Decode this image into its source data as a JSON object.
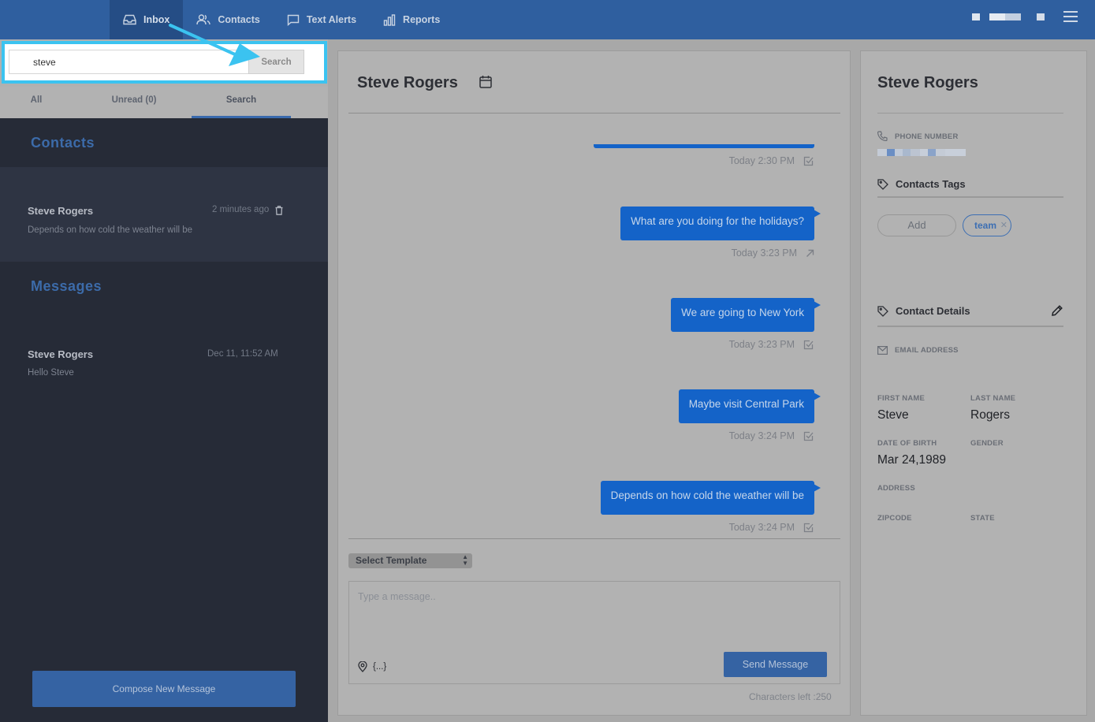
{
  "nav": {
    "items": [
      {
        "label": "Inbox",
        "icon": "inbox-icon",
        "active": true
      },
      {
        "label": "Contacts",
        "icon": "contacts-icon",
        "active": false
      },
      {
        "label": "Text Alerts",
        "icon": "chat-bubble-icon",
        "active": false
      },
      {
        "label": "Reports",
        "icon": "bar-chart-icon",
        "active": false
      }
    ],
    "menu_icon": "hamburger-icon"
  },
  "search": {
    "value": "steve",
    "button_label": "Search"
  },
  "tabs": [
    {
      "label": "All",
      "active": false
    },
    {
      "label": "Unread (0)",
      "active": false
    },
    {
      "label": "Search",
      "active": true
    }
  ],
  "results": {
    "contacts_heading": "Contacts",
    "contact": {
      "name": "Steve Rogers",
      "time": "2 minutes ago",
      "snippet": "Depends on how cold the weather will be"
    },
    "messages_heading": "Messages",
    "message": {
      "name": "Steve Rogers",
      "time": "Dec 11, 11:52 AM",
      "snippet": "Hello Steve"
    }
  },
  "compose_button": "Compose New Message",
  "conversation": {
    "title": "Steve Rogers",
    "messages": [
      {
        "text": "",
        "time": "Today 2:30 PM",
        "status_icon": "check-square-icon"
      },
      {
        "text": "What are you doing for the holidays?",
        "time": "Today 3:23 PM",
        "status_icon": "arrow-up-right-icon"
      },
      {
        "text": "We are going to New York",
        "time": "Today 3:23 PM",
        "status_icon": "check-square-icon"
      },
      {
        "text": "Maybe visit Central Park",
        "time": "Today 3:24 PM",
        "status_icon": "check-square-icon"
      },
      {
        "text": "Depends on how cold the weather will be",
        "time": "Today 3:24 PM",
        "status_icon": "check-square-icon"
      }
    ],
    "template_select": "Select Template",
    "message_placeholder": "Type a message..",
    "variables_label": "{...}",
    "send_label": "Send Message",
    "chars_left": "Characters left :250"
  },
  "details": {
    "title": "Steve Rogers",
    "phone_label": "PHONE NUMBER",
    "tags_heading": "Contacts Tags",
    "add_tag_label": "Add",
    "tags": [
      "team"
    ],
    "details_heading": "Contact Details",
    "email_label": "EMAIL ADDRESS",
    "first_name_label": "FIRST NAME",
    "first_name": "Steve",
    "last_name_label": "LAST NAME",
    "last_name": "Rogers",
    "dob_label": "DATE OF BIRTH",
    "dob": "Mar 24,1989",
    "gender_label": "GENDER",
    "address_label": "ADDRESS",
    "zipcode_label": "ZIPCODE",
    "state_label": "STATE"
  },
  "colors": {
    "nav_bg": "#2f5f9f",
    "sidebar_bg": "#262b37",
    "bubble": "#1463c8",
    "highlight": "#3bc3f0"
  }
}
